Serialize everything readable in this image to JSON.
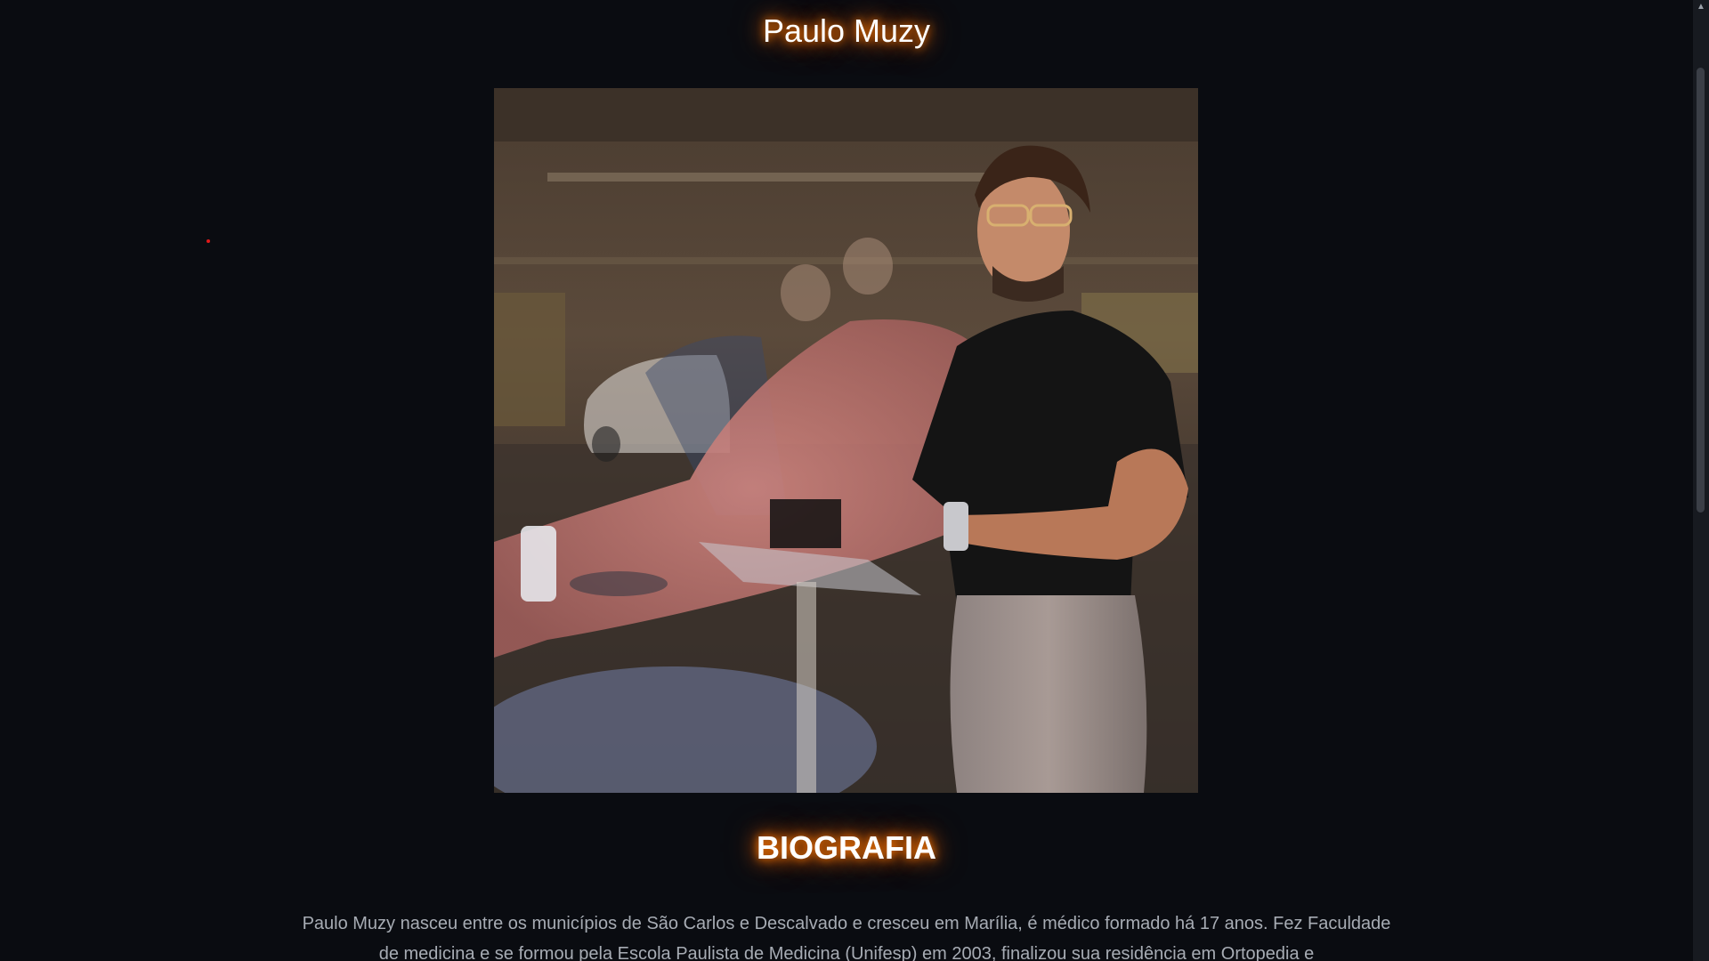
{
  "page": {
    "title": "Paulo Muzy"
  },
  "hero": {
    "image_alt": "Paulo Muzy"
  },
  "biography": {
    "heading": "BIOGRAFIA",
    "text": "Paulo Muzy nasceu entre os municípios de São Carlos e Descalvado e cresceu em Marília, é médico formado há 17 anos. Fez Faculdade de medicina e se formou pela Escola Paulista de Medicina (Unifesp) em 2003, finalizou sua residência em Ortopedia e"
  },
  "theme": {
    "background": "#0a0c11",
    "glow": "#ff7a00",
    "body_text": "#a7acb4"
  },
  "icons": {
    "scroll_up": "chevron-up-icon"
  }
}
